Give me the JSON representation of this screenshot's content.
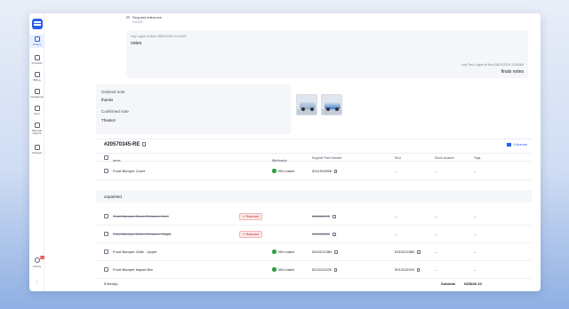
{
  "sidebar": {
    "items": [
      {
        "label": "Orders",
        "icon": "orders-icon",
        "active": true
      },
      {
        "label": "Products",
        "icon": "tag-icon"
      },
      {
        "label": "Billing",
        "icon": "billing-icon"
      },
      {
        "label": "Intelligence",
        "icon": "intelligence-icon"
      },
      {
        "label": "Sync",
        "icon": "sync-icon"
      },
      {
        "label": "Damage capture",
        "icon": "car-icon"
      },
      {
        "label": "Settings",
        "icon": "gear-icon"
      }
    ],
    "activity": {
      "label": "Activity",
      "badge": "99"
    },
    "more": "⋮"
  },
  "thread": {
    "reference_label": "Request reference",
    "reference_value": "vn1223",
    "note1_meta": "Izzy Logue at Wed 28/01/2026 10:41AM",
    "note1_text": "notes",
    "note2_meta": "Izzy Test Logue at Wed 28/01/2026 10:53AM",
    "note2_text": "finals notes"
  },
  "ordered": {
    "ordered_label": "Ordered note",
    "ordered_value": "thanks",
    "confirmed_label": "Confirmed note",
    "confirmed_value": "Thanks!"
  },
  "order": {
    "title": "#20570345-RE",
    "columns_label": "Columns",
    "headers": {
      "items": "Items",
      "verification": "Verification",
      "supplier_part": "Supplier Part Number",
      "sku": "SKU",
      "stock_location": "Stock location",
      "tags": "Tags"
    },
    "rows": [
      {
        "name": "Front Bumper Cover",
        "status": "",
        "verification": "VIN match",
        "part": "5211914958",
        "sku": "--",
        "stock": "--",
        "tags": "--",
        "struck": false
      },
      {
        "name": "Front Bumper Cover Retainer - Left",
        "status": "Returned",
        "verification": "",
        "part": "521612470",
        "sku": "--",
        "stock": "--",
        "tags": "--",
        "struck": true
      },
      {
        "name": "Front Bumper Cover Retainer - Right",
        "status": "Returned",
        "verification": "",
        "part": "521612520",
        "sku": "--",
        "stock": "--",
        "tags": "--",
        "struck": true
      },
      {
        "name": "Front Bumper Grille - Upper",
        "status": "",
        "verification": "VIN match",
        "part": "5310212360",
        "sku": "5310212360",
        "stock": "--",
        "tags": "--",
        "struck": false
      },
      {
        "name": "Front Bumper Impact Bar",
        "status": "",
        "verification": "VIN match",
        "part": "5213112320",
        "sku": "5213112320",
        "stock": "--",
        "tags": "--",
        "struck": false
      }
    ],
    "group_label": "unpainted",
    "footer": {
      "items_count": "5 item(s)",
      "subtotal_label": "Subtotal",
      "subtotal_value": "NZ$626.33"
    }
  }
}
